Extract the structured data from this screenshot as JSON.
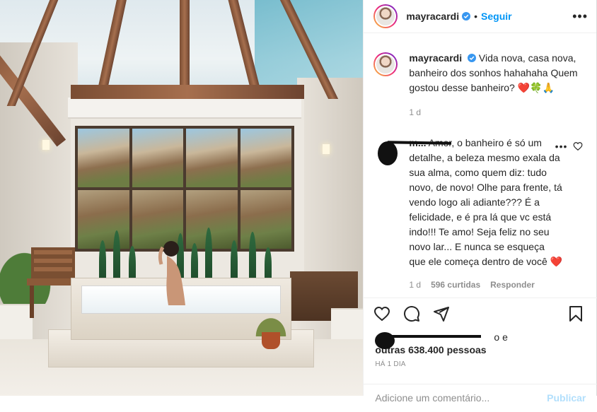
{
  "post": {
    "username": "mayracardi",
    "follow_label": "Seguir",
    "separator": "•"
  },
  "caption": {
    "username": "mayracardi",
    "text": "Vida nova, casa nova, banheiro dos sonhos hahahaha Quem gostou desse banheiro?",
    "emoji": "❤️🍀🙏",
    "time": "1 d"
  },
  "comment": {
    "username_fragment": "m...",
    "text": "Amor, o banheiro é só um detalhe, a beleza mesmo exala da sua alma, como quem diz: tudo novo, de novo! Olhe para frente, tá vendo logo ali adiante??? É a felicidade, e é pra lá que vc está indo!!! Te amo! Seja feliz no seu novo lar... E nunca se esqueça que ele começa dentro de você",
    "emoji": "❤️",
    "time": "1 d",
    "likes": "596 curtidas",
    "reply_label": "Responder"
  },
  "likes": {
    "first_line_suffix": "o e",
    "others": "outras 638.400 pessoas"
  },
  "posted_ago": "HÁ 1 DIA",
  "add_comment": {
    "placeholder": "Adicione um comentário...",
    "publish_label": "Publicar"
  },
  "icons": {
    "header_more": "more-options-icon",
    "verified": "verified-badge-icon",
    "like": "heart-icon",
    "comment": "comment-icon",
    "share": "share-icon",
    "save": "bookmark-icon"
  },
  "colors": {
    "accent": "#0095f6",
    "verified": "#3897f0",
    "muted": "#8e8e8e",
    "text": "#262626",
    "heart": "#ed4956"
  }
}
